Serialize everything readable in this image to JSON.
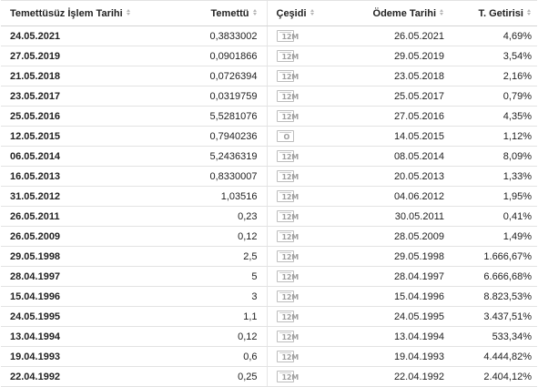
{
  "table": {
    "headers": {
      "date": "Temettüsüz İşlem Tarihi",
      "dividend": "Temettü",
      "type": "Çeşidi",
      "payment": "Ödeme Tarihi",
      "yield": "T. Getirisi"
    },
    "rows": [
      {
        "date": "24.05.2021",
        "dividend": "0,3833002",
        "type": "12M",
        "payment": "26.05.2021",
        "yield": "4,69%"
      },
      {
        "date": "27.05.2019",
        "dividend": "0,0901866",
        "type": "12M",
        "payment": "29.05.2019",
        "yield": "3,54%"
      },
      {
        "date": "21.05.2018",
        "dividend": "0,0726394",
        "type": "12M",
        "payment": "23.05.2018",
        "yield": "2,16%"
      },
      {
        "date": "23.05.2017",
        "dividend": "0,0319759",
        "type": "12M",
        "payment": "25.05.2017",
        "yield": "0,79%"
      },
      {
        "date": "25.05.2016",
        "dividend": "5,5281076",
        "type": "12M",
        "payment": "27.05.2016",
        "yield": "4,35%"
      },
      {
        "date": "12.05.2015",
        "dividend": "0,7940236",
        "type": "O",
        "payment": "14.05.2015",
        "yield": "1,12%"
      },
      {
        "date": "06.05.2014",
        "dividend": "5,2436319",
        "type": "12M",
        "payment": "08.05.2014",
        "yield": "8,09%"
      },
      {
        "date": "16.05.2013",
        "dividend": "0,8330007",
        "type": "12M",
        "payment": "20.05.2013",
        "yield": "1,33%"
      },
      {
        "date": "31.05.2012",
        "dividend": "1,03516",
        "type": "12M",
        "payment": "04.06.2012",
        "yield": "1,95%"
      },
      {
        "date": "26.05.2011",
        "dividend": "0,23",
        "type": "12M",
        "payment": "30.05.2011",
        "yield": "0,41%"
      },
      {
        "date": "26.05.2009",
        "dividend": "0,12",
        "type": "12M",
        "payment": "28.05.2009",
        "yield": "1,49%"
      },
      {
        "date": "29.05.1998",
        "dividend": "2,5",
        "type": "12M",
        "payment": "29.05.1998",
        "yield": "1.666,67%"
      },
      {
        "date": "28.04.1997",
        "dividend": "5",
        "type": "12M",
        "payment": "28.04.1997",
        "yield": "6.666,68%"
      },
      {
        "date": "15.04.1996",
        "dividend": "3",
        "type": "12M",
        "payment": "15.04.1996",
        "yield": "8.823,53%"
      },
      {
        "date": "24.05.1995",
        "dividend": "1,1",
        "type": "12M",
        "payment": "24.05.1995",
        "yield": "3.437,51%"
      },
      {
        "date": "13.04.1994",
        "dividend": "0,12",
        "type": "12M",
        "payment": "13.04.1994",
        "yield": "533,34%"
      },
      {
        "date": "19.04.1993",
        "dividend": "0,6",
        "type": "12M",
        "payment": "19.04.1993",
        "yield": "4.444,82%"
      },
      {
        "date": "22.04.1992",
        "dividend": "0,25",
        "type": "12M",
        "payment": "22.04.1992",
        "yield": "2.404,12%"
      }
    ]
  },
  "icons": {
    "sort": "sort-icon",
    "type_badge": "calendar-icon"
  }
}
